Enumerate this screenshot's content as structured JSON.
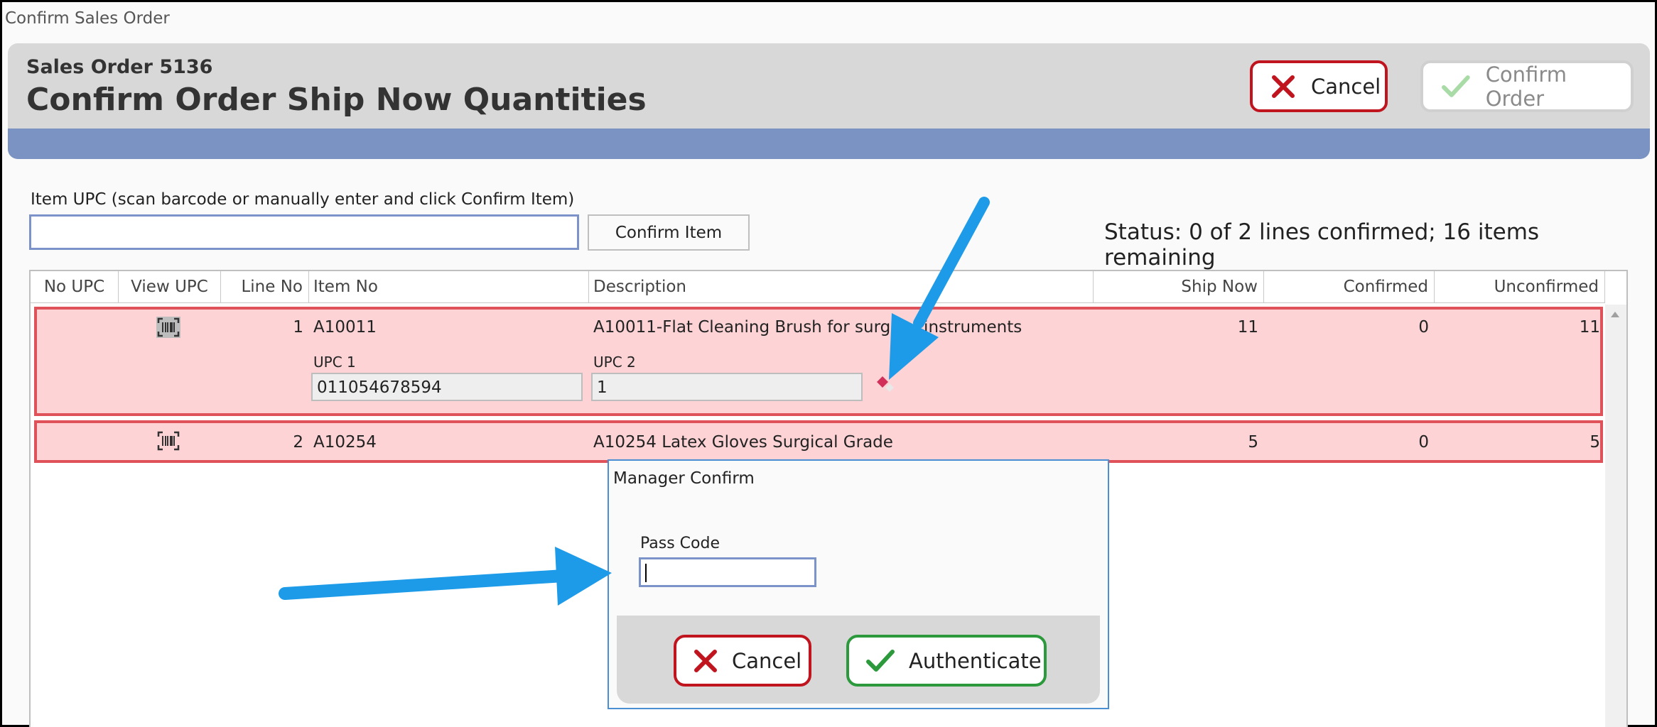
{
  "window": {
    "title": "Confirm Sales Order"
  },
  "header": {
    "subtitle": "Sales Order 5136",
    "title": "Confirm Order Ship Now Quantities",
    "cancel_label": "Cancel",
    "confirm_order_label": "Confirm Order"
  },
  "scan": {
    "label": "Item UPC (scan barcode or manually enter and click Confirm Item)",
    "value": "",
    "confirm_item_label": "Confirm Item"
  },
  "status": "Status: 0 of 2 lines confirmed; 16 items remaining",
  "grid": {
    "columns": [
      "No UPC",
      "View UPC",
      "Line No",
      "Item No",
      "Description",
      "Ship Now",
      "Confirmed",
      "Unconfirmed"
    ],
    "rows": [
      {
        "line_no": "1",
        "item_no": "A10011",
        "description": "A10011-Flat Cleaning Brush for surgical instruments",
        "ship_now": "11",
        "confirmed": "0",
        "unconfirmed": "11",
        "upc1_label": "UPC 1",
        "upc1_value": "011054678594",
        "upc2_label": "UPC 2",
        "upc2_value": "1"
      },
      {
        "line_no": "2",
        "item_no": "A10254",
        "description": "A10254 Latex Gloves Surgical Grade",
        "ship_now": "5",
        "confirmed": "0",
        "unconfirmed": "5"
      }
    ]
  },
  "dialog": {
    "title": "Manager Confirm",
    "pass_label": "Pass Code",
    "pass_value": "",
    "cancel_label": "Cancel",
    "authenticate_label": "Authenticate"
  },
  "colors": {
    "accent_band": "#7a93c2",
    "row_error_bg": "#fdd3d5",
    "row_error_border": "#e0525a",
    "cancel_red": "#c0141f",
    "confirm_green": "#2c9a3c",
    "annotation_arrow": "#1e9be8"
  },
  "icons": [
    "x-icon",
    "check-icon",
    "barcode-icon",
    "delete-diamond-icon",
    "annotation-arrow"
  ]
}
